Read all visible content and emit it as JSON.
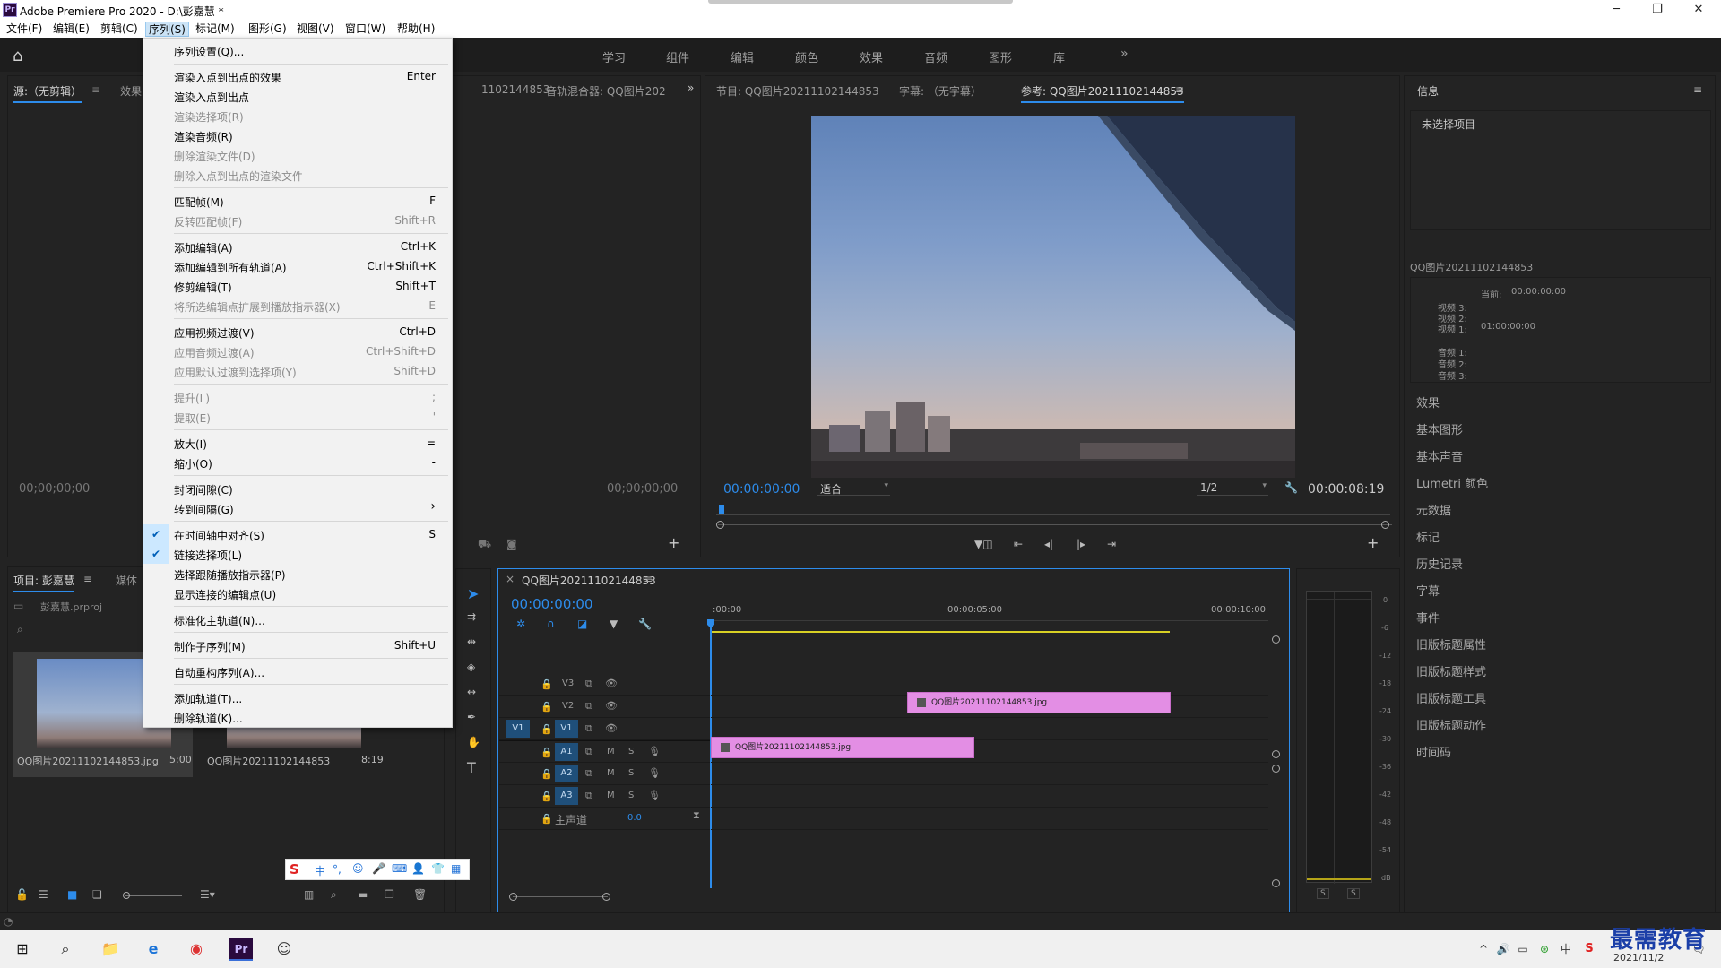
{
  "window": {
    "title": "Adobe Premiere Pro 2020 - D:\\彭嘉慧 *",
    "app_icon": "Pr"
  },
  "menubar": [
    {
      "label": "文件(F)"
    },
    {
      "label": "编辑(E)"
    },
    {
      "label": "剪辑(C)"
    },
    {
      "label": "序列(S)"
    },
    {
      "label": "标记(M)"
    },
    {
      "label": "图形(G)"
    },
    {
      "label": "视图(V)"
    },
    {
      "label": "窗口(W)"
    },
    {
      "label": "帮助(H)"
    }
  ],
  "workspaces": [
    "学习",
    "组件",
    "编辑",
    "颜色",
    "效果",
    "音频",
    "图形",
    "库"
  ],
  "sequence_menu": {
    "items": [
      {
        "label": "序列设置(Q)...",
        "shortcut": "",
        "disabled": false,
        "checked": false
      },
      {
        "label": "渲染入点到出点的效果",
        "shortcut": "Enter",
        "disabled": false,
        "checked": false
      },
      {
        "label": "渲染入点到出点",
        "shortcut": "",
        "disabled": false,
        "checked": false
      },
      {
        "label": "渲染选择项(R)",
        "shortcut": "",
        "disabled": true,
        "checked": false
      },
      {
        "label": "渲染音频(R)",
        "shortcut": "",
        "disabled": false,
        "checked": false
      },
      {
        "label": "删除渲染文件(D)",
        "shortcut": "",
        "disabled": true,
        "checked": false
      },
      {
        "label": "删除入点到出点的渲染文件",
        "shortcut": "",
        "disabled": true,
        "checked": false
      },
      {
        "label": "匹配帧(M)",
        "shortcut": "F",
        "disabled": false,
        "checked": false
      },
      {
        "label": "反转匹配帧(F)",
        "shortcut": "Shift+R",
        "disabled": true,
        "checked": false
      },
      {
        "label": "添加编辑(A)",
        "shortcut": "Ctrl+K",
        "disabled": false,
        "checked": false
      },
      {
        "label": "添加编辑到所有轨道(A)",
        "shortcut": "Ctrl+Shift+K",
        "disabled": false,
        "checked": false
      },
      {
        "label": "修剪编辑(T)",
        "shortcut": "Shift+T",
        "disabled": false,
        "checked": false
      },
      {
        "label": "将所选编辑点扩展到播放指示器(X)",
        "shortcut": "E",
        "disabled": true,
        "checked": false
      },
      {
        "label": "应用视频过渡(V)",
        "shortcut": "Ctrl+D",
        "disabled": false,
        "checked": false
      },
      {
        "label": "应用音频过渡(A)",
        "shortcut": "Ctrl+Shift+D",
        "disabled": true,
        "checked": false
      },
      {
        "label": "应用默认过渡到选择项(Y)",
        "shortcut": "Shift+D",
        "disabled": true,
        "checked": false
      },
      {
        "label": "提升(L)",
        "shortcut": ";",
        "disabled": true,
        "checked": false
      },
      {
        "label": "提取(E)",
        "shortcut": "'",
        "disabled": true,
        "checked": false
      },
      {
        "label": "放大(I)",
        "shortcut": "=",
        "disabled": false,
        "checked": false
      },
      {
        "label": "缩小(O)",
        "shortcut": "-",
        "disabled": false,
        "checked": false
      },
      {
        "label": "封闭间隙(C)",
        "shortcut": "",
        "disabled": false,
        "checked": false
      },
      {
        "label": "转到间隔(G)",
        "shortcut": "›",
        "disabled": false,
        "checked": false
      },
      {
        "label": "在时间轴中对齐(S)",
        "shortcut": "S",
        "disabled": false,
        "checked": true
      },
      {
        "label": "链接选择项(L)",
        "shortcut": "",
        "disabled": false,
        "checked": true
      },
      {
        "label": "选择跟随播放指示器(P)",
        "shortcut": "",
        "disabled": false,
        "checked": false
      },
      {
        "label": "显示连接的编辑点(U)",
        "shortcut": "",
        "disabled": false,
        "checked": false
      },
      {
        "label": "标准化主轨道(N)...",
        "shortcut": "",
        "disabled": false,
        "checked": false
      },
      {
        "label": "制作子序列(M)",
        "shortcut": "Shift+U",
        "disabled": false,
        "checked": false
      },
      {
        "label": "自动重构序列(A)...",
        "shortcut": "",
        "disabled": false,
        "checked": false
      },
      {
        "label": "添加轨道(T)...",
        "shortcut": "",
        "disabled": false,
        "checked": false
      },
      {
        "label": "删除轨道(K)...",
        "shortcut": "",
        "disabled": false,
        "checked": false
      }
    ]
  },
  "source_panel": {
    "tab": "源:（无剪辑）",
    "tab2": "效果",
    "timecode_left": "00;00;00;00",
    "timecode_right": "00;00;00;00"
  },
  "audio_mixer": {
    "tab1": "1102144853",
    "tab2": "音轨混合器: QQ图片202"
  },
  "program_panel": {
    "tab1": "节目: QQ图片20211102144853",
    "tab2": "字幕: （无字幕）",
    "tab3": "参考: QQ图片20211102144853",
    "timecode": "00:00:00:00",
    "fit": "适合",
    "resolution": "1/2",
    "duration": "00:00:08:19"
  },
  "project_panel": {
    "tab1": "项目: 彭嘉慧",
    "tab2": "媒体",
    "file": "彭嘉慧.prproj",
    "items": [
      {
        "name": "QQ图片20211102144853.jpg",
        "duration": "5:00"
      },
      {
        "name": "QQ图片20211102144853",
        "duration": "8:19"
      }
    ]
  },
  "timeline": {
    "tab": "QQ图片20211102144853",
    "timecode": "00:00:00:00",
    "ruler": [
      ":00:00",
      "00:00:05:00",
      "00:00:10:00"
    ],
    "tracks": [
      {
        "id": "V3",
        "type": "video"
      },
      {
        "id": "V2",
        "type": "video"
      },
      {
        "id": "V1",
        "type": "video",
        "source": "V1"
      },
      {
        "id": "A1",
        "type": "audio"
      },
      {
        "id": "A2",
        "type": "audio"
      },
      {
        "id": "A3",
        "type": "audio"
      }
    ],
    "master": {
      "label": "主声道",
      "value": "0.0"
    },
    "clips": [
      {
        "track": "V3",
        "name": "QQ图片20211102144853.jpg"
      },
      {
        "track": "V1",
        "name": "QQ图片20211102144853.jpg"
      }
    ]
  },
  "audio_meter": {
    "scale": [
      "0",
      "-6",
      "-12",
      "-18",
      "-24",
      "-30",
      "-36",
      "-42",
      "-48",
      "-54",
      "dB"
    ],
    "solo": [
      "S",
      "S"
    ]
  },
  "info_panel": {
    "tab": "信息",
    "none_selected": "未选择项目",
    "sequence_name": "QQ图片20211102144853",
    "current_label": "当前:",
    "current_value": "00:00:00:00",
    "video_tracks": [
      {
        "label": "视频 3:",
        "value": ""
      },
      {
        "label": "视频 2:",
        "value": ""
      },
      {
        "label": "视频 1:",
        "value": "01:00:00:00"
      }
    ],
    "audio_tracks": [
      {
        "label": "音频 1:"
      },
      {
        "label": "音频 2:"
      },
      {
        "label": "音频 3:"
      }
    ]
  },
  "right_panels": [
    "效果",
    "基本图形",
    "基本声音",
    "Lumetri 颜色",
    "元数据",
    "标记",
    "历史记录",
    "字幕",
    "事件",
    "旧版标题属性",
    "旧版标题样式",
    "旧版标题工具",
    "旧版标题动作",
    "时间码"
  ],
  "ime_toolbar": {
    "label": "中"
  },
  "watermark": "最需教育",
  "taskbar": {
    "date": "2021/11/2"
  },
  "colors": {
    "accent": "#2d8ceb",
    "clip": "#e38ee4",
    "panel_bg": "#232323"
  }
}
